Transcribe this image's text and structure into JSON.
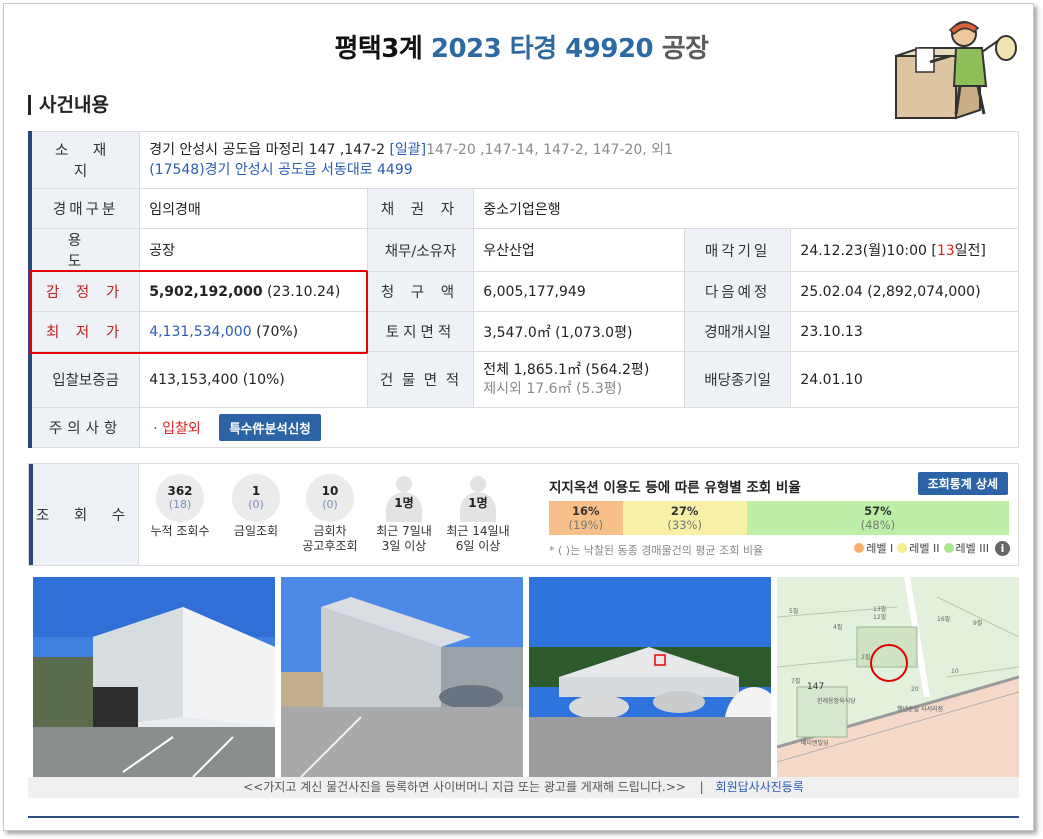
{
  "header": {
    "court": "평택3계",
    "case_no": "2023 타경 49920",
    "category": "공장"
  },
  "section_title": "사건내용",
  "info": {
    "address_label": "소 재 지",
    "address_line1": "경기 안성시 공도읍 마정리 147 ,147-2",
    "address_bulk": "[일괄]",
    "address_bulk_rest": "147-20 ,147-14, 147-2, 147-20, 외1",
    "address_line2": "(17548)경기 안성시  공도읍 서동대로  4499",
    "auction_type_label": "경매구분",
    "auction_type": "임의경매",
    "creditor_label": "채 권 자",
    "creditor": "중소기업은행",
    "usage_label": "용 도",
    "usage": "공장",
    "debtor_label": "채무/소유자",
    "debtor": "우산산업",
    "sale_date_label": "매각기일",
    "sale_date": "24.12.23(월)10:00 [",
    "sale_date_days": "13",
    "sale_date_suffix": "일전]",
    "appraisal_label": "감 정 가",
    "appraisal_value": "5,902,192,000",
    "appraisal_date": " (23.10.24)",
    "claim_label": "청 구 액",
    "claim": "6,005,177,949",
    "next_label": "다음예정",
    "next_value": "25.02.04 (2,892,074,000)",
    "minimum_label": "최 저 가",
    "minimum_value": "4,131,534,000",
    "minimum_pct": " (70%)",
    "land_label": "토지면적",
    "land": "3,547.0㎡ (1,073.0평)",
    "start_label": "경매개시일",
    "start": "23.10.13",
    "deposit_label": "입찰보증금",
    "deposit": "413,153,400 (10%)",
    "building_label": "건 물 면 적",
    "building_line1": "전체 1,865.1㎡ (564.2평)",
    "building_line2": "제시외 17.6㎡ (5.3평)",
    "dividend_label": "배당종기일",
    "dividend": "24.01.10",
    "notes_label": "주의사항",
    "notes_item": "· 입찰외",
    "notes_button": "특수件분석신청"
  },
  "views": {
    "label": "조 회 수",
    "items": [
      {
        "value": "362",
        "sub": "(18)",
        "caption1": "누적 조회수",
        "caption2": ""
      },
      {
        "value": "1",
        "sub": "(0)",
        "caption1": "금일조회",
        "caption2": ""
      },
      {
        "value": "10",
        "sub": "(0)",
        "caption1": "금회차",
        "caption2": "공고후조회"
      },
      {
        "value": "1명",
        "sub": "",
        "caption1": "최근 7일내",
        "caption2": "3일 이상"
      },
      {
        "value": "1명",
        "sub": "",
        "caption1": "최근 14일내",
        "caption2": "6일 이상"
      }
    ],
    "ratio_title": "지지옥션 이용도 등에 따른 유형별 조회 비율",
    "ratio_button": "조회통계 상세",
    "bars": [
      {
        "pct": "16%",
        "sub": "(19%)",
        "color": "#f7c08a",
        "share": 0.16
      },
      {
        "pct": "27%",
        "sub": "(33%)",
        "color": "#f7f0a6",
        "share": 0.27
      },
      {
        "pct": "57%",
        "sub": "(48%)",
        "color": "#bdf0a6",
        "share": 0.57
      }
    ],
    "note": "* ( )는 낙찰된 동종 경매물건의 평균 조회 비율",
    "legend": [
      {
        "label": "레벨 I",
        "color": "#f7b06a"
      },
      {
        "label": "레벨 II",
        "color": "#f7ee92"
      },
      {
        "label": "레벨 III",
        "color": "#a8e890"
      }
    ],
    "info_icon": "i"
  },
  "photos": {
    "map_labels": [
      "147",
      "7필",
      "2필",
      "5필",
      "4필",
      "9필",
      "16필",
      "10",
      "20",
      "메이앤빌딩",
      "한레옹정육식당",
      "행년순실 사서리점",
      "13필",
      "12필"
    ]
  },
  "caption": {
    "text": "<<가지고 계신 물건사진을 등록하면 사이버머니 지급 또는 광고를 게재해 드립니다.>>",
    "sep": "|",
    "link": "회원답사사진등록"
  }
}
